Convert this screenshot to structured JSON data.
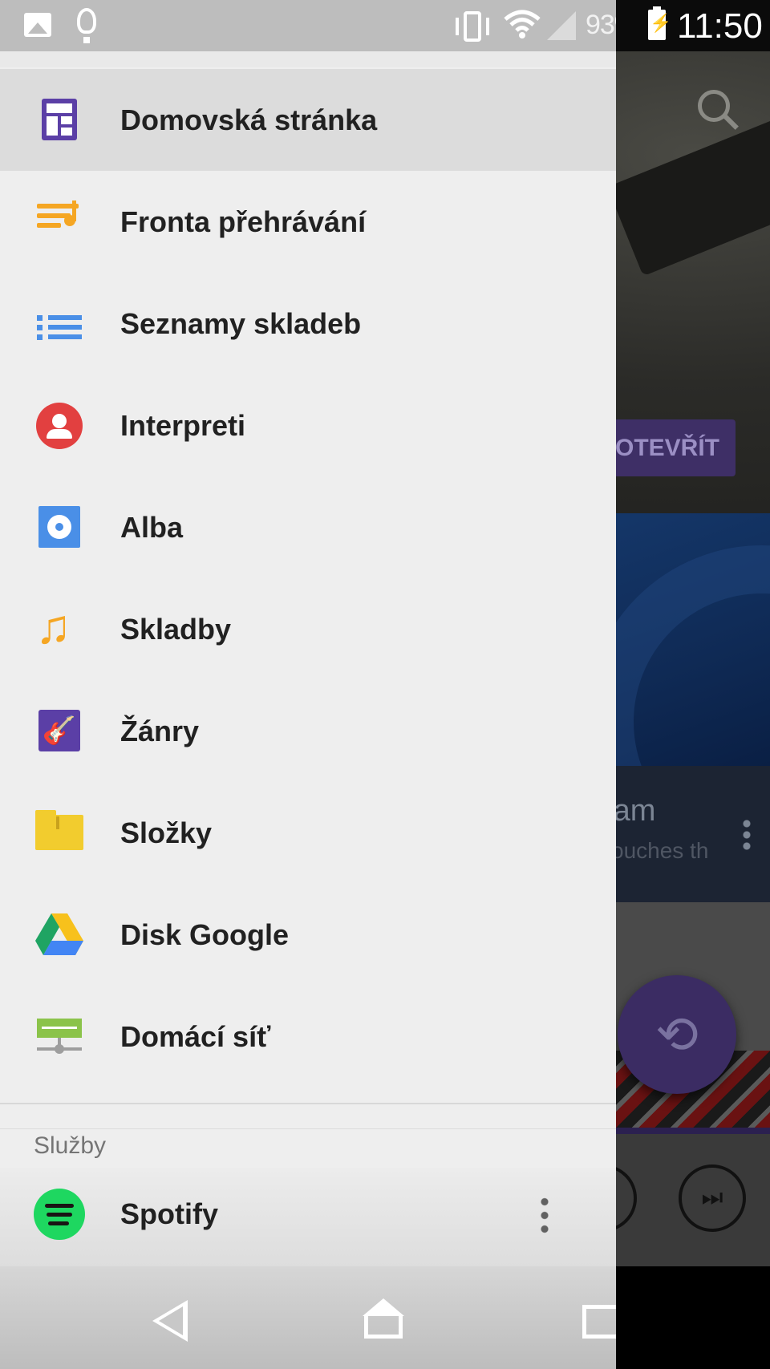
{
  "status_bar": {
    "battery_percent": "93",
    "percent_sign": "%",
    "time": "11:50",
    "icons": [
      "image-notification-icon",
      "lightbulb-icon",
      "vibrate-icon",
      "wifi-icon",
      "signal-icon",
      "battery-charging-icon"
    ]
  },
  "background_app": {
    "open_button": "OTEVŘÍT",
    "card_title": "ram",
    "card_subtitle": "ouches th"
  },
  "drawer": {
    "items": [
      {
        "label": "Domovská stránka",
        "icon": "home-grid-icon",
        "active": true
      },
      {
        "label": "Fronta přehrávání",
        "icon": "play-queue-icon",
        "active": false
      },
      {
        "label": "Seznamy skladeb",
        "icon": "playlist-icon",
        "active": false
      },
      {
        "label": "Interpreti",
        "icon": "artist-icon",
        "active": false
      },
      {
        "label": "Alba",
        "icon": "album-icon",
        "active": false
      },
      {
        "label": "Skladby",
        "icon": "music-note-icon",
        "active": false
      },
      {
        "label": "Žánry",
        "icon": "guitar-icon",
        "active": false
      },
      {
        "label": "Složky",
        "icon": "folder-icon",
        "active": false
      },
      {
        "label": "Disk Google",
        "icon": "google-drive-icon",
        "active": false
      },
      {
        "label": "Domácí síť",
        "icon": "home-network-icon",
        "active": false
      }
    ],
    "services_header": "Služby",
    "services": [
      {
        "label": "Spotify",
        "icon": "spotify-icon"
      }
    ]
  },
  "navigation_bar": {
    "buttons": [
      "back-icon",
      "home-icon",
      "recents-icon"
    ]
  },
  "colors": {
    "drawer_bg": "#eeeeee",
    "active_item_bg": "#dcdcdc",
    "accent_purple": "#5b3fa6",
    "orange": "#f5a623",
    "blue": "#4a8fe7",
    "red": "#e24040",
    "spotify_green": "#1ed760"
  }
}
